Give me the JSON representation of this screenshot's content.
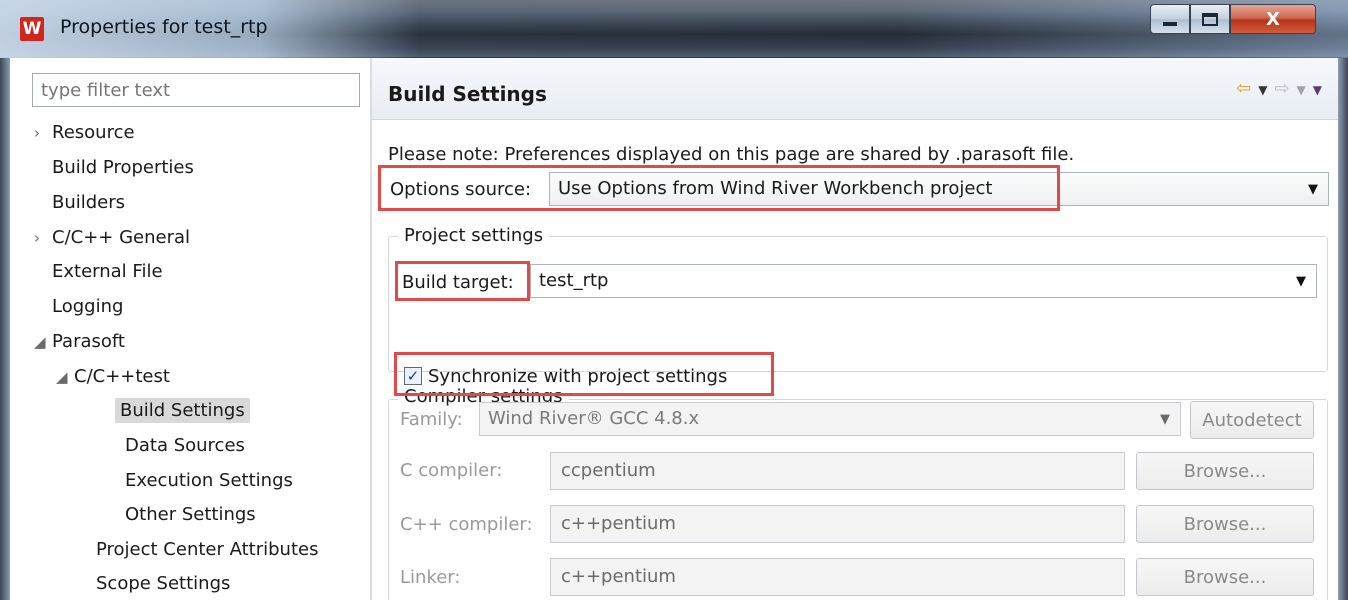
{
  "window": {
    "app_logo": "W",
    "title": "Properties for test_rtp",
    "close_glyph": "X"
  },
  "left": {
    "filter_placeholder": "type filter text",
    "tree": [
      {
        "label": "Resource",
        "arrow": "›"
      },
      {
        "label": "Build Properties",
        "arrow": ""
      },
      {
        "label": "Builders",
        "arrow": ""
      },
      {
        "label": "C/C++ General",
        "arrow": "›"
      },
      {
        "label": "External File",
        "arrow": ""
      },
      {
        "label": "Logging",
        "arrow": ""
      },
      {
        "label": "Parasoft",
        "arrow": "◢"
      },
      {
        "label": "C/C++test",
        "arrow": "◢"
      },
      {
        "label": "Build Settings",
        "arrow": ""
      },
      {
        "label": "Data Sources",
        "arrow": ""
      },
      {
        "label": "Execution Settings",
        "arrow": ""
      },
      {
        "label": "Other Settings",
        "arrow": ""
      },
      {
        "label": "Project Center Attributes",
        "arrow": ""
      },
      {
        "label": "Scope Settings",
        "arrow": ""
      }
    ]
  },
  "page": {
    "title": "Build Settings",
    "note": "Please note: Preferences displayed on this page are shared by .parasoft file.",
    "options_source_label": "Options source:",
    "options_source_value": "Use Options from Wind River Workbench project",
    "project_settings_title": "Project settings",
    "build_target_label": "Build target:",
    "build_target_value": "test_rtp",
    "compiler_settings_title": "Compiler settings",
    "synchronize_label": "Synchronize with project settings",
    "synchronize_checked": true,
    "family_label": "Family:",
    "family_value": "Wind River® GCC 4.8.x",
    "autodetect_label": "Autodetect",
    "c_compiler_label": "C compiler:",
    "c_compiler_value": "ccpentium",
    "cpp_compiler_label": "C++ compiler:",
    "cpp_compiler_value": "c++pentium",
    "linker_label": "Linker:",
    "linker_value": "c++pentium",
    "browse_label": "Browse..."
  },
  "colors": {
    "highlight": "#e24a4a",
    "selected_bg": "#d9d9d9"
  }
}
